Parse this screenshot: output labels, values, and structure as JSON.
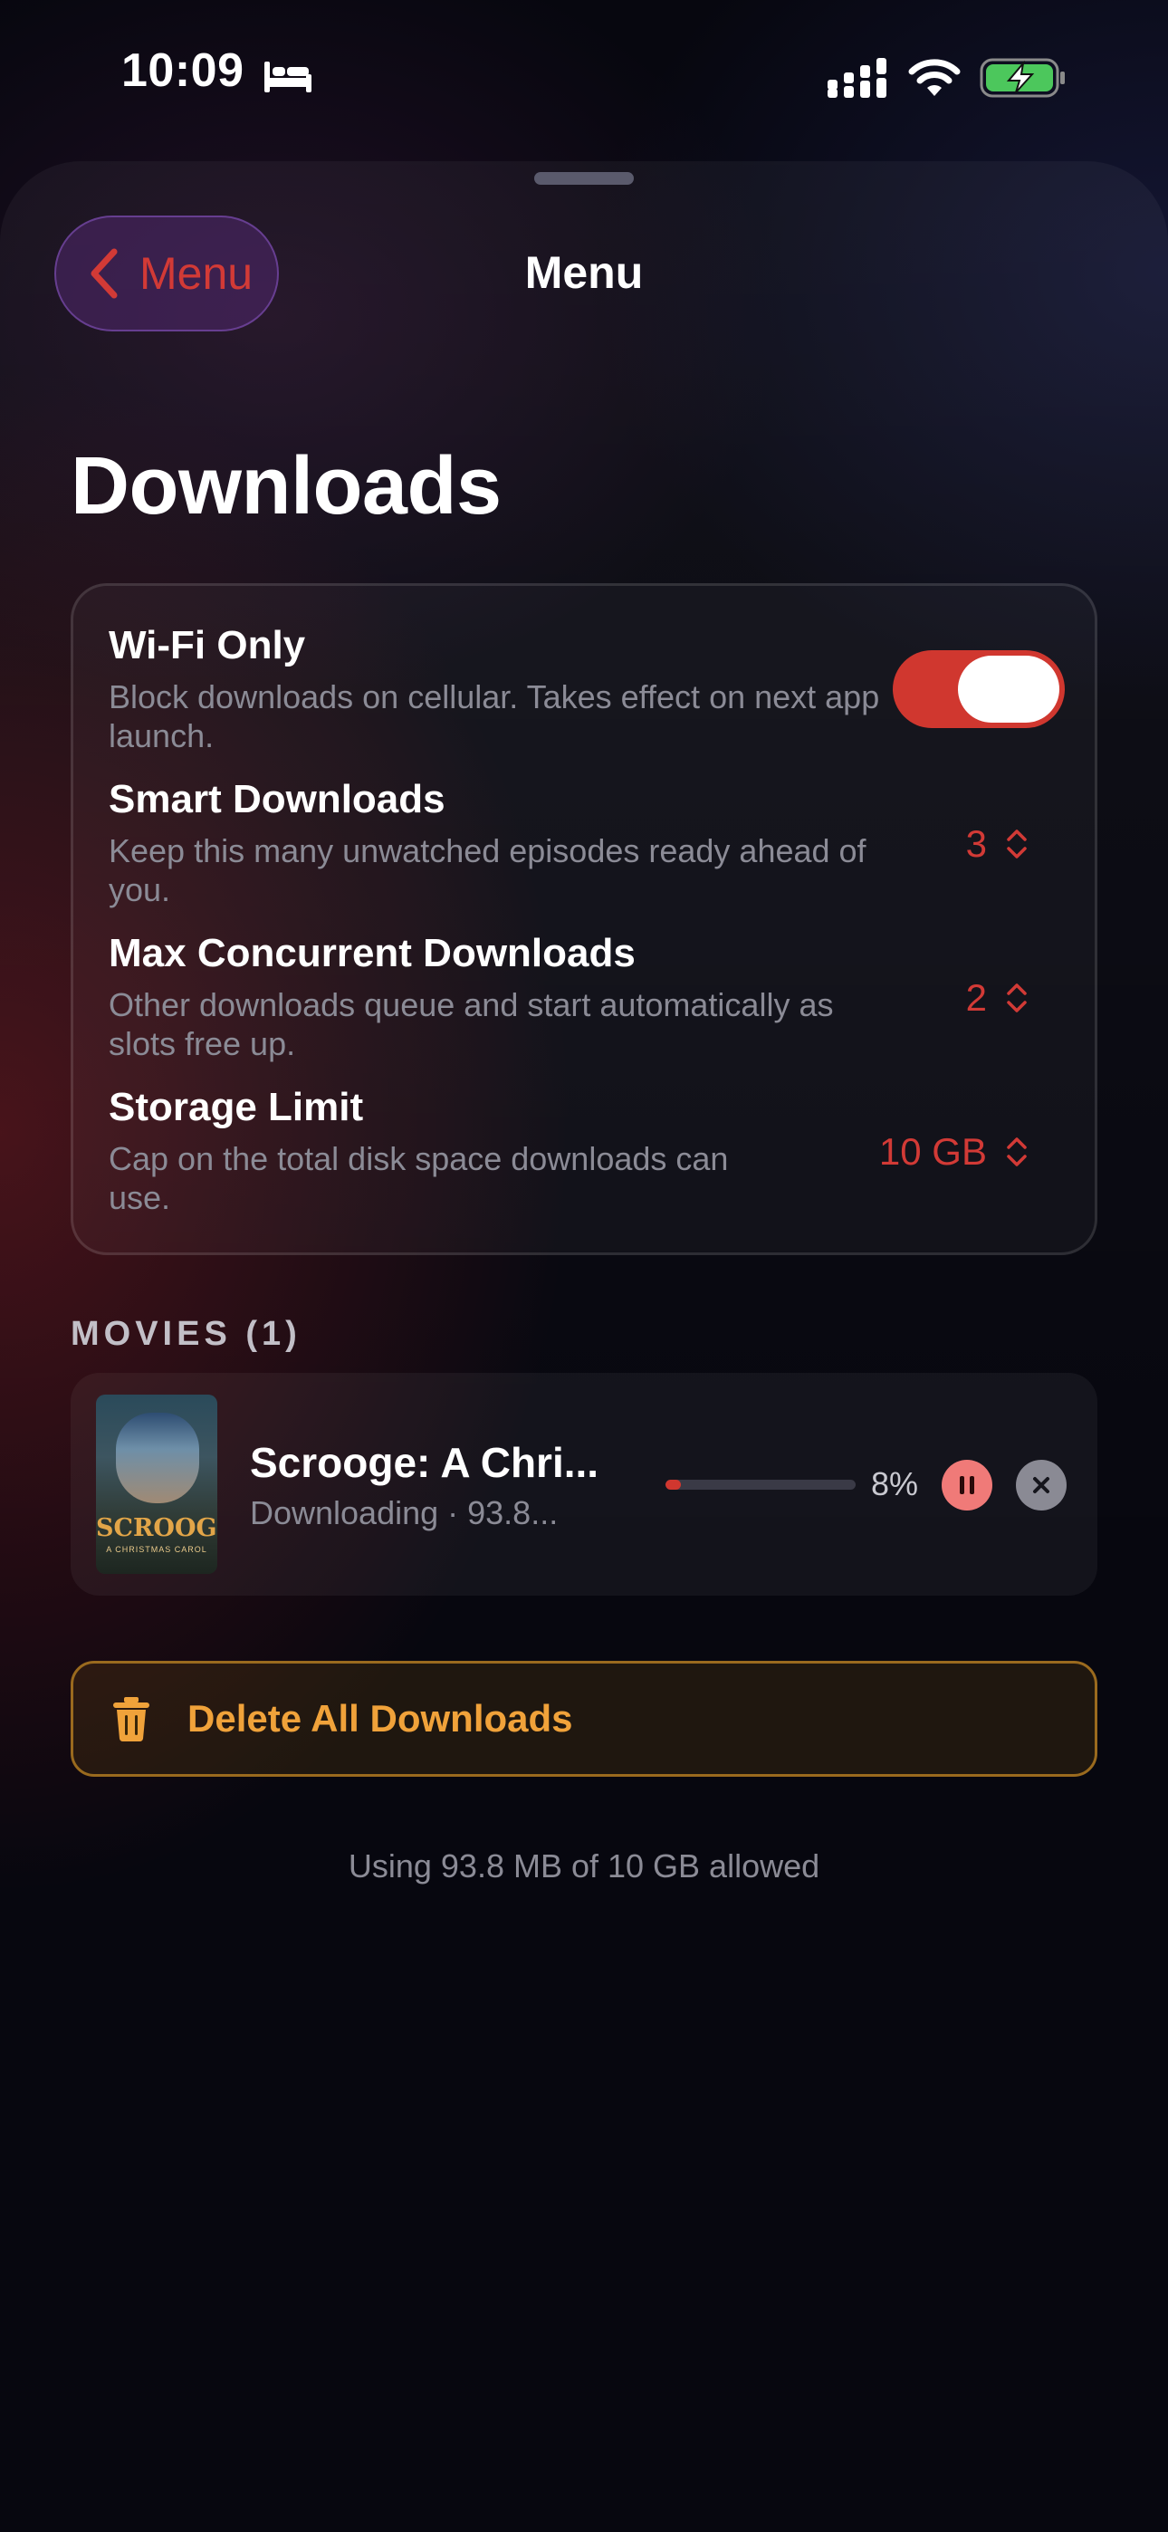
{
  "status_bar": {
    "time": "10:09",
    "icons": [
      "bed-icon",
      "signal-icon",
      "wifi-icon",
      "battery-charging-icon"
    ]
  },
  "nav": {
    "back_label": "Menu",
    "title": "Menu"
  },
  "page": {
    "title": "Downloads"
  },
  "settings": {
    "wifi_only": {
      "title": "Wi-Fi Only",
      "subtitle": "Block downloads on cellular. Takes effect on next app launch.",
      "enabled": true
    },
    "smart_downloads": {
      "title": "Smart Downloads",
      "subtitle": "Keep this many unwatched episodes ready ahead of you.",
      "value": "3"
    },
    "max_concurrent": {
      "title": "Max Concurrent Downloads",
      "subtitle": "Other downloads queue and start automatically as slots free up.",
      "value": "2"
    },
    "storage_limit": {
      "title": "Storage Limit",
      "subtitle": "Cap on the total disk space downloads can use.",
      "value": "10 GB"
    }
  },
  "movies": {
    "header": "MOVIES (1)",
    "items": [
      {
        "title": "Scrooge: A Chri...",
        "status": "Downloading · 93.8...",
        "progress": 0.08,
        "progress_label": "8%",
        "poster_title": "SCROOGE",
        "poster_subtitle": "A CHRISTMAS CAROL"
      }
    ]
  },
  "actions": {
    "delete_all_label": "Delete All Downloads"
  },
  "footer": {
    "usage": "Using 93.8 MB of 10 GB allowed"
  },
  "colors": {
    "accent": "#d0372f",
    "warning": "#f0a23a",
    "background": "#07070f"
  }
}
